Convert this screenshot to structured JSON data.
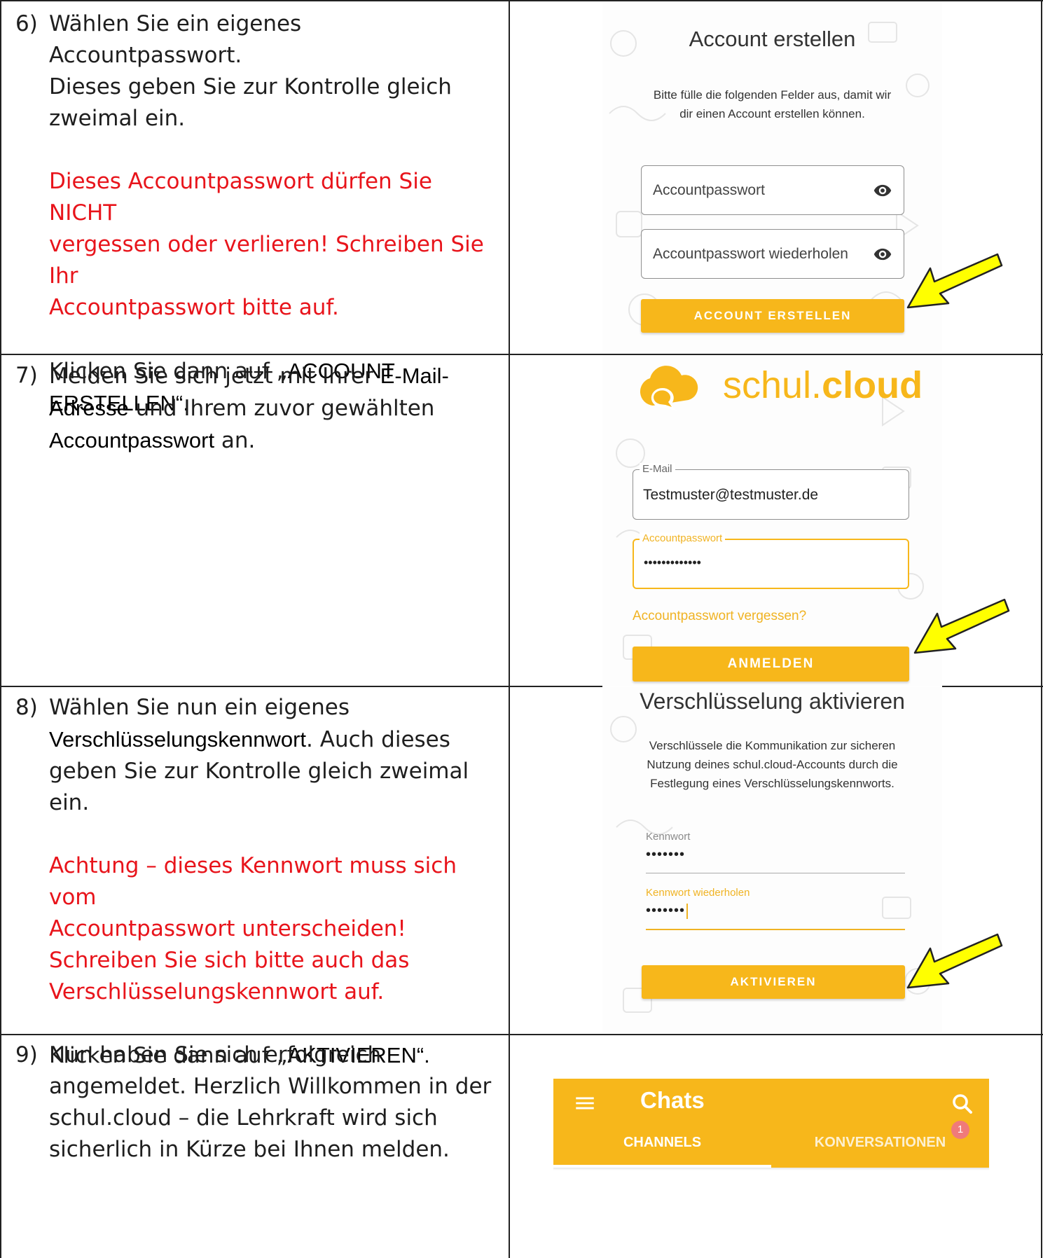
{
  "steps": [
    {
      "number": "6)",
      "lines": [
        "Wählen Sie ein eigenes Accountpasswort.",
        "Dieses geben Sie zur Kontrolle gleich",
        "zweimal ein."
      ],
      "warning": [
        "Dieses Accountpasswort dürfen Sie NICHT",
        "vergessen oder verlieren! Schreiben Sie Ihr",
        "Accountpasswort bitte auf."
      ],
      "click_prefix": "Klicken Sie dann auf „",
      "click_target_1": "ACCOUNT",
      "click_target_2": "ERSTELLEN",
      "click_suffix": "“."
    },
    {
      "number": "7)",
      "line1_prefix": "Melden Sie sich jetzt mit Ihrer ",
      "line1_em": "E-Mail-",
      "line2_em": "Adresse",
      "line2_rest": " und Ihrem zuvor gewählten",
      "line3_em": "Accountpasswort",
      "line3_rest": " an."
    },
    {
      "number": "8)",
      "line1": "Wählen Sie nun ein eigenes",
      "line2_em": "Verschlüsselungskennwort",
      "line2_rest": ". Auch dieses",
      "line3": "geben Sie zur Kontrolle gleich zweimal ein.",
      "warning": [
        "Achtung – dieses Kennwort muss sich vom",
        "Accountpasswort unterscheiden!",
        "Schreiben Sie sich bitte auch das",
        "Verschlüsselungskennwort auf."
      ],
      "click_prefix": "Klicken Sie dann auf „",
      "click_target": "AKTIVIEREN",
      "click_suffix": "“."
    },
    {
      "number": "9)",
      "lines": [
        "Nun haben Sie sich erfolgreich",
        "angemeldet. Herzlich Willkommen in der",
        "schul.cloud – die Lehrkraft wird sich",
        "sicherlich in Kürze bei Ihnen melden."
      ]
    }
  ],
  "screen_create_account": {
    "title": "Account erstellen",
    "subtitle": [
      "Bitte fülle die folgenden Felder aus, damit wir",
      "dir einen Account erstellen können."
    ],
    "password_placeholder": "Accountpasswort",
    "repeat_placeholder": "Accountpasswort wiederholen",
    "button": "ACCOUNT ERSTELLEN"
  },
  "screen_login": {
    "logo_plain": "schul.",
    "logo_bold": "cloud",
    "email_label": "E-Mail",
    "email_value": "Testmuster@testmuster.de",
    "password_label": "Accountpasswort",
    "password_value": "•••••••••••••",
    "forgot_link": "Accountpasswort vergessen?",
    "button": "ANMELDEN"
  },
  "screen_encryption": {
    "title": "Verschlüsselung aktivieren",
    "subtitle": [
      "Verschlüssele die Kommunikation zur sicheren",
      "Nutzung deines schul.cloud-Accounts durch die",
      "Festlegung eines Verschlüsselungskennworts."
    ],
    "password_label": "Kennwort",
    "password_value": "•••••••",
    "repeat_label": "Kennwort wiederholen",
    "repeat_value": "•••••••",
    "button": "AKTIVIEREN"
  },
  "screen_chats": {
    "title": "Chats",
    "tab_channels": "CHANNELS",
    "tab_conversations": "KONVERSATIONEN",
    "badge_count": "1"
  },
  "colors": {
    "brand_yellow": "#f7b71b",
    "warning_red": "#e8141b",
    "arrow_yellow": "#ffff00"
  }
}
